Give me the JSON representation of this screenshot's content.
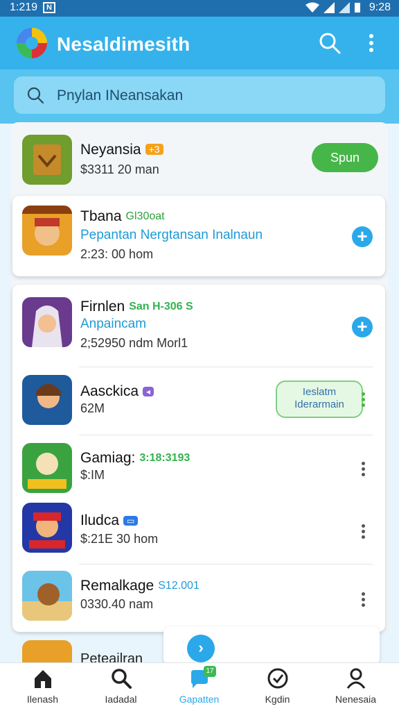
{
  "status_bar": {
    "time": "1:219",
    "notification_letter": "N",
    "clock": "9:28"
  },
  "header": {
    "title": "Nesaldimesith"
  },
  "search": {
    "placeholder": "Pnylan INeansakan"
  },
  "apps": [
    {
      "name": "Neyansia",
      "badge": "+3",
      "meta": "$3311 20 man",
      "action": "Spun"
    },
    {
      "name": "Tbana",
      "badge": "Gl30oat",
      "subtitle": "Pepantan Nergtansan Inalnaun",
      "meta": "2:23: 00 hom"
    },
    {
      "name": "Firnlen",
      "badge": "San H-306 S",
      "subtitle": "Anpaincam",
      "meta": "2;52950 ndm Morl1"
    },
    {
      "name": "Aasckica",
      "meta": "62M",
      "action_line1": "Ieslatm",
      "action_line2": "Iderarmain"
    },
    {
      "name": "Gamiag:",
      "badge": "3:18:3193",
      "meta": "$:IM"
    },
    {
      "name": "Iludca",
      "meta": "$:21E 30 hom"
    },
    {
      "name": "Remalkage",
      "badge": "S12.001",
      "meta": "0330.40 nam"
    },
    {
      "name": "Peteailran"
    }
  ],
  "bottom_nav": [
    {
      "label": "Ilenash",
      "icon": "home-icon"
    },
    {
      "label": "Iadadal",
      "icon": "search-icon"
    },
    {
      "label": "Gapatten",
      "icon": "chat-icon",
      "badge": "17",
      "active": true
    },
    {
      "label": "Kgdin",
      "icon": "check-circle-icon"
    },
    {
      "label": "Nenesaia",
      "icon": "profile-icon"
    }
  ],
  "colors": {
    "header": "#35b2ec",
    "accent": "#2ba8ea",
    "green": "#46b648"
  }
}
